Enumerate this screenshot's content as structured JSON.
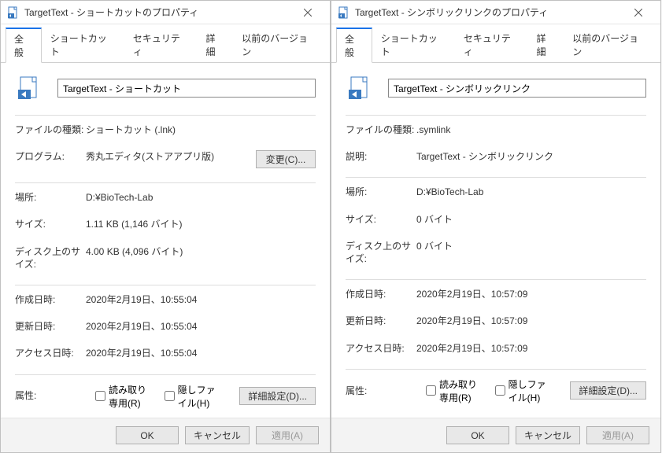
{
  "left": {
    "title": "TargetText - ショートカットのプロパティ",
    "tabs": [
      "全般",
      "ショートカット",
      "セキュリティ",
      "詳細",
      "以前のバージョン"
    ],
    "filename": "TargetText - ショートカット",
    "rows": {
      "filetype_label": "ファイルの種類:",
      "filetype_value": "ショートカット (.lnk)",
      "program_label": "プログラム:",
      "program_value": "秀丸エディタ(ストアアプリ版)",
      "change_btn": "変更(C)...",
      "location_label": "場所:",
      "location_value": "D:¥BioTech-Lab",
      "size_label": "サイズ:",
      "size_value": "1.11 KB (1,146 バイト)",
      "disksize_label": "ディスク上のサイズ:",
      "disksize_value": "4.00 KB (4,096 バイト)",
      "created_label": "作成日時:",
      "created_value": "2020年2月19日、10:55:04",
      "modified_label": "更新日時:",
      "modified_value": "2020年2月19日、10:55:04",
      "accessed_label": "アクセス日時:",
      "accessed_value": "2020年2月19日、10:55:04",
      "attr_label": "属性:",
      "readonly_label": "読み取り専用(R)",
      "hidden_label": "隠しファイル(H)",
      "advanced_btn": "詳細設定(D)..."
    },
    "buttons": {
      "ok": "OK",
      "cancel": "キャンセル",
      "apply": "適用(A)"
    }
  },
  "right": {
    "title": "TargetText - シンボリックリンクのプロパティ",
    "tabs": [
      "全般",
      "ショートカット",
      "セキュリティ",
      "詳細",
      "以前のバージョン"
    ],
    "filename": "TargetText - シンボリックリンク",
    "rows": {
      "filetype_label": "ファイルの種類:",
      "filetype_value": ".symlink",
      "desc_label": "説明:",
      "desc_value": "TargetText - シンボリックリンク",
      "location_label": "場所:",
      "location_value": "D:¥BioTech-Lab",
      "size_label": "サイズ:",
      "size_value": "0 バイト",
      "disksize_label": "ディスク上のサイズ:",
      "disksize_value": "0 バイト",
      "created_label": "作成日時:",
      "created_value": "2020年2月19日、10:57:09",
      "modified_label": "更新日時:",
      "modified_value": "2020年2月19日、10:57:09",
      "accessed_label": "アクセス日時:",
      "accessed_value": "2020年2月19日、10:57:09",
      "attr_label": "属性:",
      "readonly_label": "読み取り専用(R)",
      "hidden_label": "隠しファイル(H)",
      "advanced_btn": "詳細設定(D)..."
    },
    "buttons": {
      "ok": "OK",
      "cancel": "キャンセル",
      "apply": "適用(A)"
    }
  }
}
